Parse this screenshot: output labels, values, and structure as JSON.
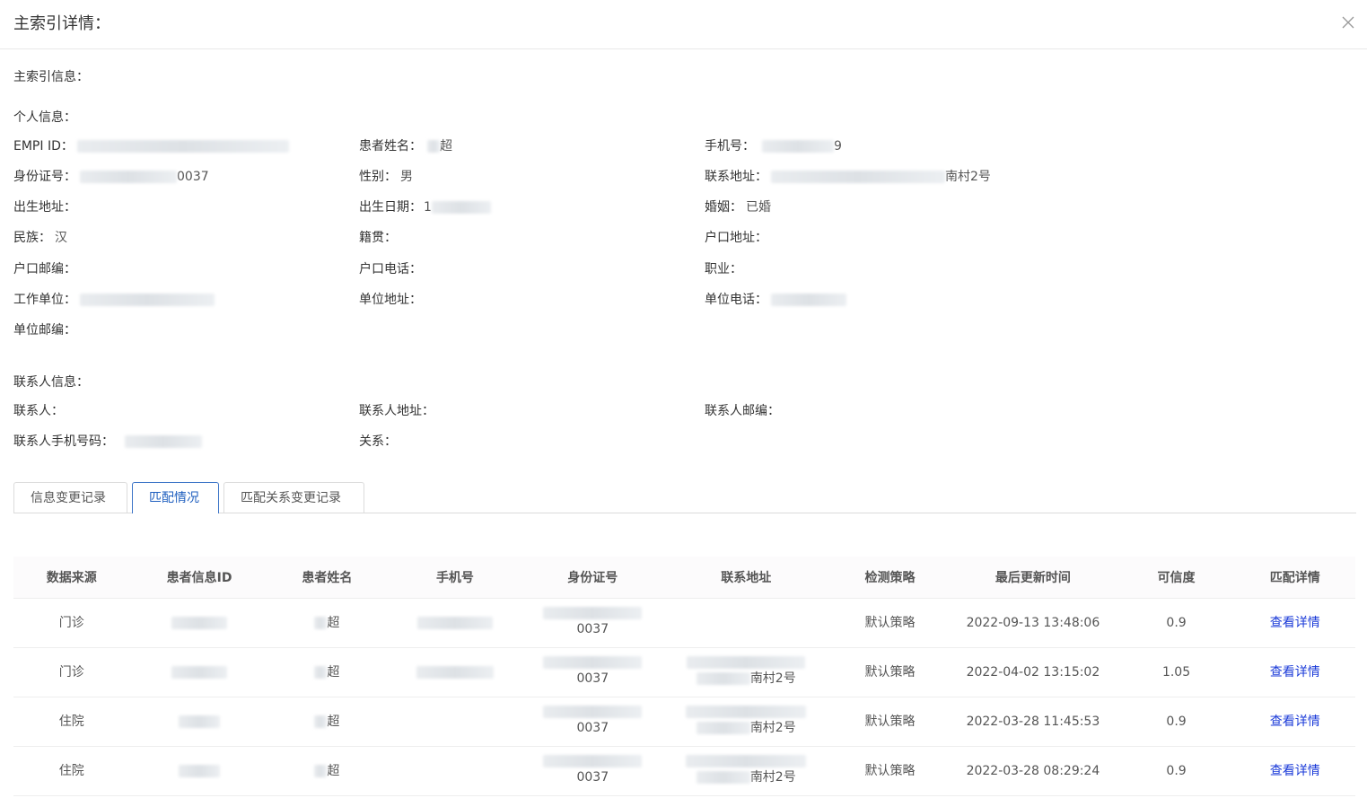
{
  "modal": {
    "title": "主索引详情："
  },
  "sections": {
    "master": "主索引信息：",
    "personal": "个人信息：",
    "contact": "联系人信息："
  },
  "personal": {
    "empi_label": "EMPI ID：",
    "name_label": "患者姓名：",
    "name_value": "超",
    "phone_label": "手机号：",
    "phone_value": "9",
    "idcard_label": "身份证号：",
    "idcard_value": "0037",
    "gender_label": "性别：",
    "gender_value": "男",
    "addr_label": "联系地址：",
    "addr_value": "南村2号",
    "birthplace_label": "出生地址：",
    "birthdate_label": "出生日期：",
    "birthdate_value": "1",
    "marriage_label": "婚姻：",
    "marriage_value": "已婚",
    "nation_label": "民族：",
    "nation_value": "汉",
    "native_label": "籍贯：",
    "hukou_label": "户口地址：",
    "hukou_zip_label": "户口邮编：",
    "hukou_phone_label": "户口电话：",
    "job_label": "职业：",
    "work_label": "工作单位：",
    "work_addr_label": "单位地址：",
    "work_phone_label": "单位电话：",
    "work_zip_label": "单位邮编："
  },
  "contact": {
    "person_label": "联系人：",
    "addr_label": "联系人地址：",
    "zip_label": "联系人邮编：",
    "phone_label": "联系人手机号码：",
    "relation_label": "关系："
  },
  "tabs": [
    "信息变更记录",
    "匹配情况",
    "匹配关系变更记录"
  ],
  "table": {
    "headers": [
      "数据来源",
      "患者信息ID",
      "患者姓名",
      "手机号",
      "身份证号",
      "联系地址",
      "检测策略",
      "最后更新时间",
      "可信度",
      "匹配详情"
    ],
    "rows": [
      {
        "source": "门诊",
        "name": "超",
        "idcard": "0037",
        "addr": "",
        "strategy": "默认策略",
        "time": "2022-09-13 13:48:06",
        "trust": "0.9",
        "action": "查看详情"
      },
      {
        "source": "门诊",
        "name": "超",
        "idcard": "0037",
        "addr": "南村2号",
        "strategy": "默认策略",
        "time": "2022-04-02 13:15:02",
        "trust": "1.05",
        "action": "查看详情"
      },
      {
        "source": "住院",
        "name": "超",
        "idcard": "0037",
        "addr": "南村2号",
        "strategy": "默认策略",
        "time": "2022-03-28 11:45:53",
        "trust": "0.9",
        "action": "查看详情"
      },
      {
        "source": "住院",
        "name": "超",
        "idcard": "0037",
        "addr": "南村2号",
        "strategy": "默认策略",
        "time": "2022-03-28 08:29:24",
        "trust": "0.9",
        "action": "查看详情"
      }
    ]
  }
}
